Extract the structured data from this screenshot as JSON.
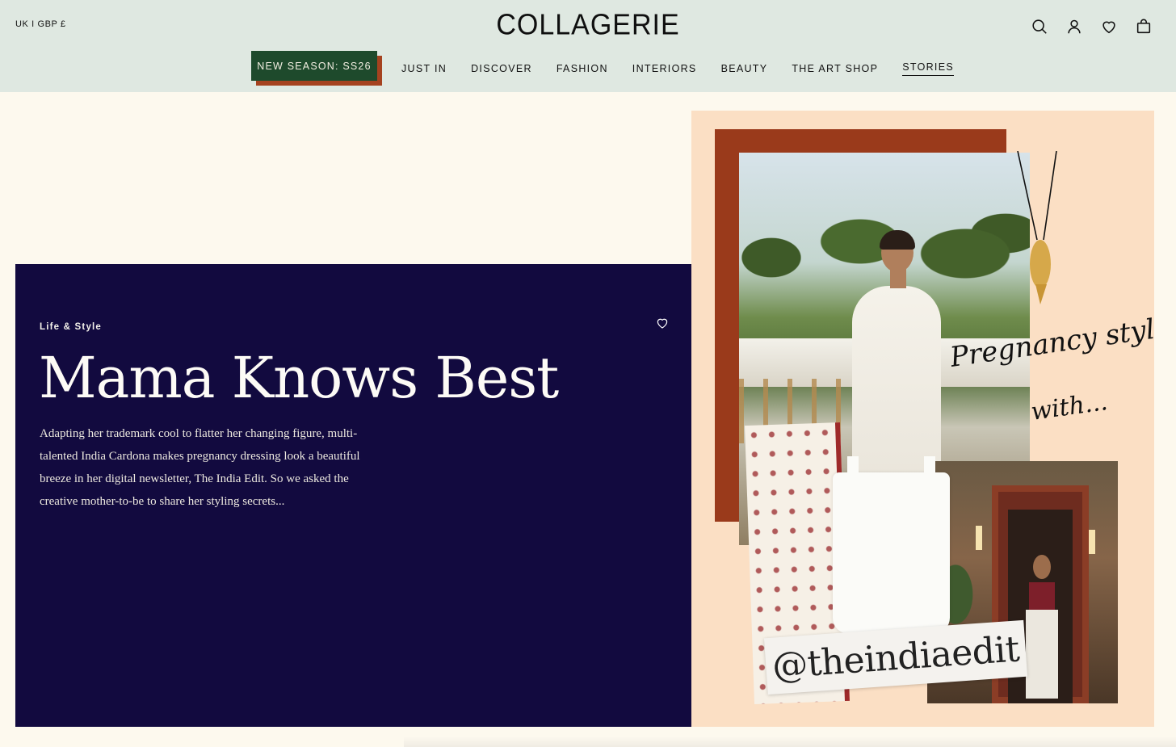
{
  "header": {
    "locale": "UK I GBP £",
    "logo": "COLLAGERIE",
    "icons": [
      "search-icon",
      "account-icon",
      "wishlist-icon",
      "bag-icon"
    ]
  },
  "nav": {
    "season_label": "NEW SEASON: SS26",
    "items": [
      {
        "label": "JUST IN"
      },
      {
        "label": "DISCOVER"
      },
      {
        "label": "FASHION"
      },
      {
        "label": "INTERIORS"
      },
      {
        "label": "BEAUTY"
      },
      {
        "label": "THE ART SHOP"
      },
      {
        "label": "STORIES",
        "active": true
      }
    ]
  },
  "hero": {
    "kicker": "Life & Style",
    "title": "Mama Knows Best",
    "body": "Adapting her trademark cool to flatter her changing figure, multi-talented India Cardona makes pregnancy dressing look a beautiful breeze in her digital newsletter, The India Edit. So we asked the creative mother-to-be to share her styling secrets..."
  },
  "collage": {
    "script_line1": "Pregnancy style",
    "script_line2": "with...",
    "handle": "@theindiaedit"
  },
  "colors": {
    "header_bg": "#dfe8e1",
    "season_green": "#1e4a2c",
    "season_shadow": "#a5421f",
    "hero_navy": "#120a3f",
    "collage_peach": "#fbdfc4",
    "page_cream": "#fdf9ee"
  }
}
